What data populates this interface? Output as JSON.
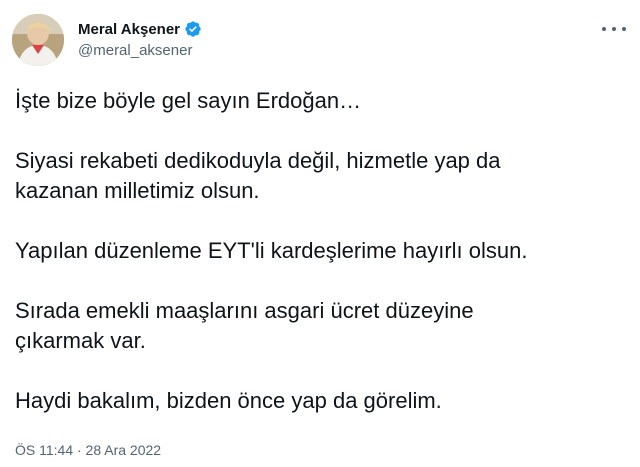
{
  "author": {
    "display_name": "Meral Akşener",
    "handle": "@meral_aksener",
    "verified_color": "#1d9bf0"
  },
  "tweet": {
    "paragraphs": [
      "İşte bize böyle gel sayın Erdoğan…",
      "Siyasi rekabeti dedikoduyla değil, hizmetle yap da\nkazanan milletimiz olsun.",
      "Yapılan düzenleme EYT'li kardeşlerime hayırlı olsun.",
      "Sırada emekli maaşlarını asgari ücret düzeyine\nçıkarmak var.",
      "Haydi bakalım, bizden önce yap da görelim."
    ],
    "timestamp": "ÖS 11:44 · 28 Ara 2022"
  },
  "icons": {
    "verified": "verified-badge-icon",
    "more": "more-options-icon"
  }
}
